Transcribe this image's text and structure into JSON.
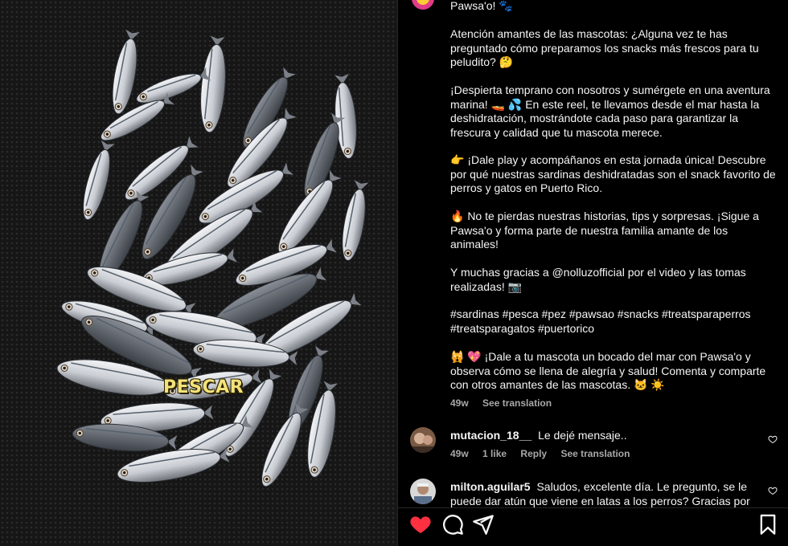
{
  "media": {
    "overlay_text": "PESCAR"
  },
  "caption": {
    "lines": [
      "Pawsa'o! 🐾",
      "Atención amantes de las mascotas: ¿Alguna vez te has",
      "preguntado cómo preparamos los snacks más frescos para tu",
      "peludito? 🤔",
      "¡Despierta temprano con nosotros y sumérgete en una aventura",
      "marina! 🚤 💦 En este reel, te llevamos desde el mar hasta la",
      "deshidratación, mostrándote cada paso para garantizar la",
      "frescura y calidad que tu mascota merece.",
      "👉 ¡Dale play y acompáñanos en esta jornada única! Descubre",
      "por qué nuestras sardinas deshidratadas son el snack favorito de",
      "perros y gatos en Puerto Rico.",
      "🔥 No te pierdas nuestras historias, tips y sorpresas. ¡Sigue a",
      "Pawsa'o y forma parte de nuestra familia amante de los",
      "animales!",
      "Y muchas gracias a @nolluzofficial por el video y las tomas",
      "realizadas! 📷",
      "#sardinas #pesca #pez #pawsao #snacks #treatsparaperros",
      "#treatsparagatos #puertorico",
      "🙀 💖 ¡Dale a tu mascota un bocado del mar con Pawsa'o y",
      "observa cómo se llena de alegría y salud! Comenta y comparte",
      "con otros amantes de las mascotas. 🐱 ☀️"
    ],
    "age": "49w",
    "see_translation": "See translation"
  },
  "comments": [
    {
      "username": "mutacion_18__",
      "text": "Le dejé mensaje..",
      "age": "49w",
      "likes": "1 like",
      "reply": "Reply",
      "see_translation": "See translation"
    },
    {
      "username": "milton.aguilar5",
      "text_line1": "Saludos, excelente día. Le pregunto, se le",
      "text_line2": "puede dar atún que viene en latas a los perros? Gracias por su"
    }
  ],
  "icons": [
    "like-icon",
    "comment-icon",
    "share-icon",
    "save-icon"
  ],
  "colors": {
    "like_red": "#ff3040",
    "muted": "#a8a8a8"
  }
}
